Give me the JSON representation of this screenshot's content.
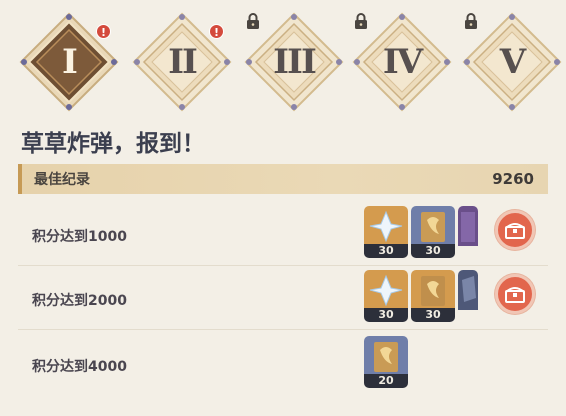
{
  "stages": [
    {
      "numeral": "I",
      "state": "active",
      "alert": "!"
    },
    {
      "numeral": "II",
      "state": "unlocked",
      "alert": "!"
    },
    {
      "numeral": "III",
      "state": "locked"
    },
    {
      "numeral": "IV",
      "state": "locked"
    },
    {
      "numeral": "V",
      "state": "locked"
    }
  ],
  "event_title": "草草炸弹，报到！",
  "best_record": {
    "label": "最佳纪录",
    "value": "9260"
  },
  "rewards_rows": [
    {
      "label": "积分达到1000",
      "rewards": [
        {
          "icon": "primogem-icon",
          "count": "30"
        },
        {
          "icon": "hero-wit-icon",
          "count": "30"
        },
        {
          "icon": "purple-book-icon",
          "count": ""
        }
      ]
    },
    {
      "label": "积分达到2000",
      "rewards": [
        {
          "icon": "primogem-icon",
          "count": "30"
        },
        {
          "icon": "hero-wit-icon",
          "count": "30"
        },
        {
          "icon": "enhancement-ore-icon",
          "count": ""
        }
      ]
    },
    {
      "label": "积分达到4000",
      "rewards": [
        {
          "icon": "hero-wit-icon",
          "count": "20"
        }
      ]
    }
  ],
  "colors": {
    "background": "#f3efe6",
    "active_stage": "#7a5a3b",
    "claim_button": "#e2664d",
    "best_record_bar": "#e6d2ab"
  }
}
